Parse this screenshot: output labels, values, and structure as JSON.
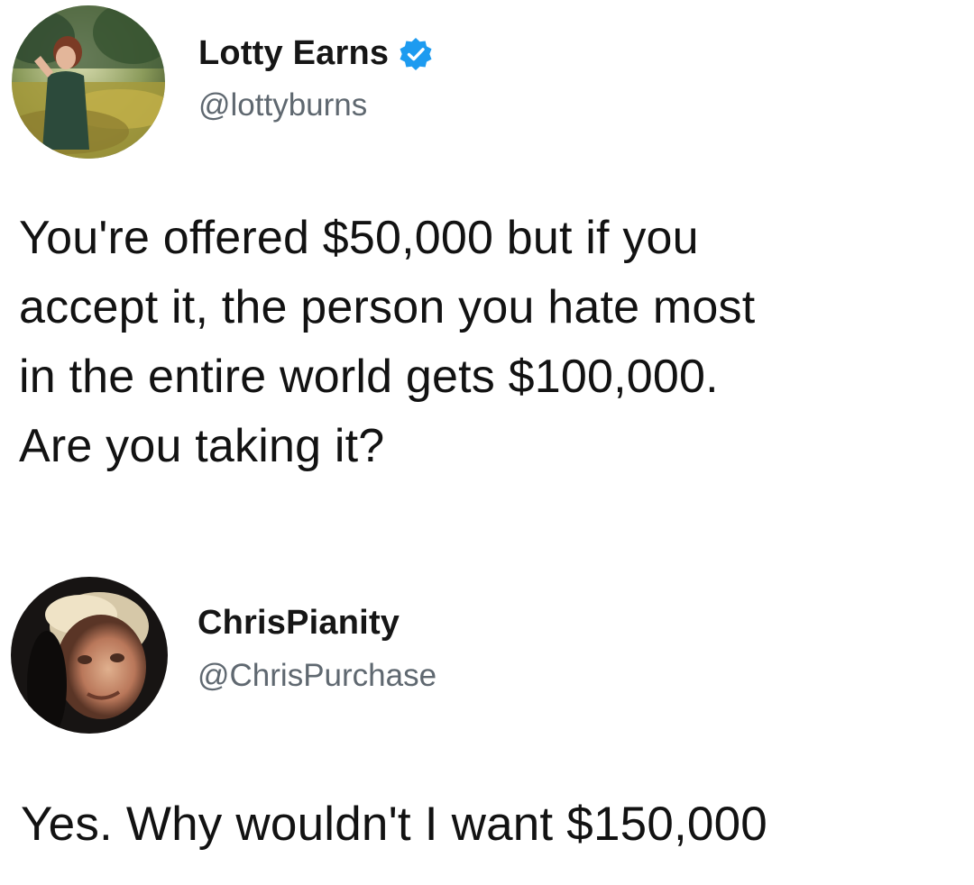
{
  "tweets": [
    {
      "author": {
        "display_name": "Lotty Earns",
        "handle": "@lottyburns",
        "verified": true,
        "avatar_icon": "profile-photo-woman-in-field"
      },
      "text_lines": [
        "You're offered $50,000 but if you",
        "accept it, the person you hate most",
        "in the entire world gets $100,000.",
        "Are you taking it?"
      ]
    },
    {
      "author": {
        "display_name": "ChrisPianity",
        "handle": "@ChrisPurchase",
        "verified": false,
        "avatar_icon": "profile-photo-man-portrait"
      },
      "text_lines": [
        "Yes. Why wouldn't I want $150,000"
      ]
    }
  ],
  "colors": {
    "background": "#ffffff",
    "text": "#121212",
    "handle": "#5f6870",
    "verified_badge": "#1d9bf0"
  }
}
